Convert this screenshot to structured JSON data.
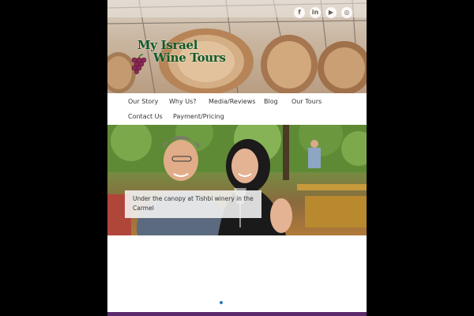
{
  "brand": {
    "logo_line1": "My Israel",
    "logo_line2": "Wine Tours"
  },
  "social": [
    {
      "icon": "facebook-icon",
      "glyph": "f"
    },
    {
      "icon": "linkedin-icon",
      "glyph": "in"
    },
    {
      "icon": "youtube-icon",
      "glyph": "▶"
    },
    {
      "icon": "tripadvisor-icon",
      "glyph": "◎"
    }
  ],
  "nav": {
    "items": [
      {
        "label": "Our Story"
      },
      {
        "label": "Why Us?"
      },
      {
        "label": "Media/Reviews"
      },
      {
        "label": "Blog"
      },
      {
        "label": "Our Tours"
      },
      {
        "label": "Contact Us"
      },
      {
        "label": "Payment/Pricing"
      }
    ]
  },
  "hero": {
    "caption": "Under the canopy at Tishbi winery in the Carmel"
  },
  "colors": {
    "background": "#000000",
    "logo_green": "#0f5a2b",
    "slider_dot": "#2a7ab8",
    "footer_purple": "#5a2a6b"
  }
}
